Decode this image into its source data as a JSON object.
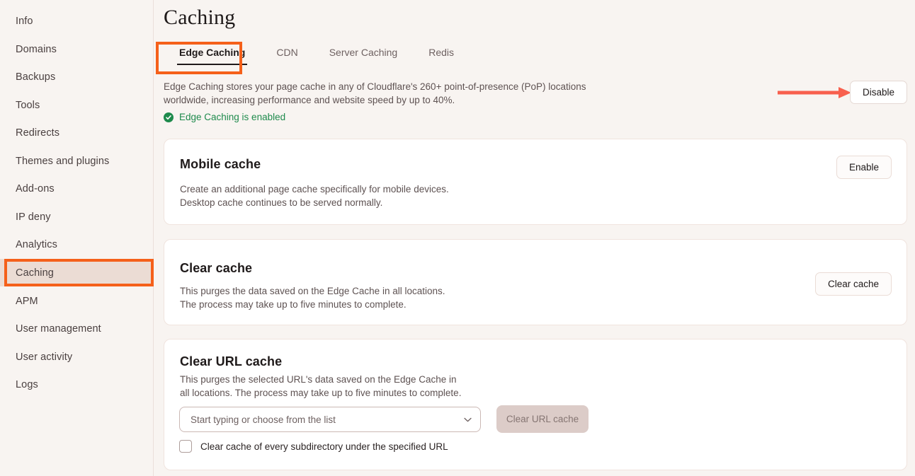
{
  "sidebar": {
    "items": [
      {
        "label": "Info",
        "active": false
      },
      {
        "label": "Domains",
        "active": false
      },
      {
        "label": "Backups",
        "active": false
      },
      {
        "label": "Tools",
        "active": false
      },
      {
        "label": "Redirects",
        "active": false
      },
      {
        "label": "Themes and plugins",
        "active": false
      },
      {
        "label": "Add-ons",
        "active": false
      },
      {
        "label": "IP deny",
        "active": false
      },
      {
        "label": "Analytics",
        "active": false
      },
      {
        "label": "Caching",
        "active": true
      },
      {
        "label": "APM",
        "active": false
      },
      {
        "label": "User management",
        "active": false
      },
      {
        "label": "User activity",
        "active": false
      },
      {
        "label": "Logs",
        "active": false
      }
    ]
  },
  "header": {
    "title": "Caching"
  },
  "tabs": [
    {
      "label": "Edge Caching",
      "active": true
    },
    {
      "label": "CDN",
      "active": false
    },
    {
      "label": "Server Caching",
      "active": false
    },
    {
      "label": "Redis",
      "active": false
    }
  ],
  "overview": {
    "description": "Edge Caching stores your page cache in any of Cloudflare's 260+ point-of-presence (PoP) locations worldwide, increasing performance and website speed by up to 40%.",
    "status_text": "Edge Caching is enabled",
    "status_icon": "check-circle-icon",
    "disable_label": "Disable"
  },
  "cards": {
    "mobile": {
      "title": "Mobile cache",
      "desc_line1": "Create an additional page cache specifically for mobile devices.",
      "desc_line2": "Desktop cache continues to be served normally.",
      "button_label": "Enable"
    },
    "clear": {
      "title": "Clear cache",
      "desc_line1": "This purges the data saved on the Edge Cache in all locations.",
      "desc_line2": "The process may take up to five minutes to complete.",
      "button_label": "Clear cache"
    },
    "url": {
      "title": "Clear URL cache",
      "desc_line1": "This purges the selected URL's data saved on the Edge Cache in",
      "desc_line2": "all locations. The process may take up to five minutes to complete.",
      "select_placeholder": "Start typing or choose from the list",
      "select_icon": "chevron-down-icon",
      "button_label": "Clear URL cache",
      "checkbox_label": "Clear cache of every subdirectory under the specified URL",
      "checkbox_checked": false
    }
  },
  "annotations": {
    "highlight_color": "#F5601A",
    "arrow_color": "#F8604E",
    "arrow_icon": "arrow-right-icon"
  },
  "colors": {
    "page_background": "#F8F4F1",
    "card_background": "#FFFFFF",
    "active_nav_background": "#EBDCD4",
    "status_green": "#1E8A4C",
    "disabled_button": "#DCCCC8"
  }
}
